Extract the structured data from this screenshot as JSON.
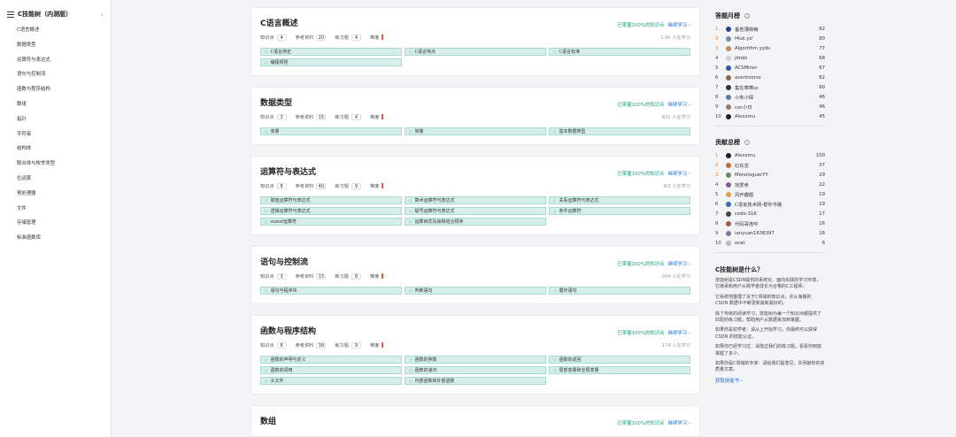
{
  "sidebar": {
    "title": "C技能树（内测版）",
    "items": [
      "C语言概述",
      "数据类型",
      "运算符与表达式",
      "语句与控制流",
      "函数与程序结构",
      "数组",
      "指针",
      "字符串",
      "结构体",
      "联合体与枚举类型",
      "位运算",
      "预处理器",
      "文件",
      "存储管理",
      "标准函数库"
    ]
  },
  "labels": {
    "knowledge": "知识点",
    "refs": "参考资料",
    "exercises": "练习题",
    "difficulty": "难度",
    "progress_link": "已掌握100%的知识点",
    "continue_link": "继续学习"
  },
  "cards": [
    {
      "title": "C语言概述",
      "k": "4",
      "r": "20",
      "e": "4",
      "learners": "1.9k 人在学习",
      "tags": [
        "C语言简史",
        "C语言特点",
        "C语言标准",
        "编程规则"
      ]
    },
    {
      "title": "数据类型",
      "k": "3",
      "r": "15",
      "e": "4",
      "learners": "821 人在学习",
      "tags": [
        "变量",
        "常量",
        "基本数据类型"
      ]
    },
    {
      "title": "运算符与表达式",
      "k": "8",
      "r": "40",
      "e": "9",
      "learners": "4/2 人在学习",
      "tags": [
        "赋值运算符与表达式",
        "算术运算符与表达式",
        "关系运算符与表达式",
        "逻辑运算符与表达式",
        "提号运算符与表达式",
        "条件运算符",
        "sizeof运算符",
        "运算目优先级和结合规序"
      ]
    },
    {
      "title": "语句与控制流",
      "k": "3",
      "r": "15",
      "e": "8",
      "learners": "204 人在学习",
      "tags": [
        "语句与程序块",
        "判断语句",
        "循环语句"
      ]
    },
    {
      "title": "函数与程序结构",
      "k": "8",
      "r": "38",
      "e": "9",
      "learners": "174 人在学习",
      "tags": [
        "函数的声明与定义",
        "函数的参数",
        "函数的返回",
        "函数的调用",
        "函数的递归",
        "局部变量和全局变量",
        "头文件",
        "内部函数和外部函数"
      ]
    },
    {
      "title": "数组",
      "k": "",
      "r": "",
      "e": "",
      "learners": "",
      "tags": []
    }
  ],
  "answer_board": {
    "title": "答题月榜",
    "rows": [
      {
        "rank": "1",
        "name": "垂若薄荷梅",
        "score": "82",
        "color": "#2b3f8f"
      },
      {
        "rank": "2",
        "name": "f4uk.yo'",
        "score": "80",
        "color": "#7a8aa0"
      },
      {
        "rank": "3",
        "name": "Algorithm yyds",
        "score": "77",
        "color": "#c48a5a"
      },
      {
        "rank": "4",
        "name": "jimds",
        "score": "68",
        "color": "#d0d0d0"
      },
      {
        "rank": "5",
        "name": "ACSMiner",
        "score": "67",
        "color": "#2f5d9a"
      },
      {
        "rank": "6",
        "name": "aventoorse",
        "score": "62",
        "color": "#8a6a4a"
      },
      {
        "rank": "7",
        "name": "集在寒寒sc",
        "score": "60",
        "color": "#333333"
      },
      {
        "rank": "8",
        "name": "小朱小琛",
        "score": "46",
        "color": "#5a7ab0"
      },
      {
        "rank": "9",
        "name": "coc小日",
        "score": "46",
        "color": "#9a7a6a"
      },
      {
        "rank": "10",
        "name": "Alexxmu",
        "score": "45",
        "color": "#222222"
      }
    ]
  },
  "contrib_board": {
    "title": "贡献总榜",
    "rows": [
      {
        "rank": "1",
        "name": "Alexxmu",
        "score": "100",
        "color": "#222222"
      },
      {
        "rank": "2",
        "name": "幻东龙",
        "score": "37",
        "color": "#c06a3a"
      },
      {
        "rank": "3",
        "name": "MonologuerYY",
        "score": "29",
        "color": "#6a8a6a"
      },
      {
        "rank": "4",
        "name": "找爱卖",
        "score": "22",
        "color": "#8a5a9a"
      },
      {
        "rank": "5",
        "name": "风开趣题",
        "score": "19",
        "color": "#e0a050"
      },
      {
        "rank": "6",
        "name": "C语言技术网-帮你今路",
        "score": "19",
        "color": "#3a6ab0"
      },
      {
        "rank": "7",
        "name": "code-316",
        "score": "17",
        "color": "#444444"
      },
      {
        "rank": "8",
        "name": "代码哥连呼",
        "score": "16",
        "color": "#a05a4a"
      },
      {
        "rank": "9",
        "name": "ianyuan1636397",
        "score": "16",
        "color": "#7a7a9a"
      },
      {
        "rank": "10",
        "name": "ocat",
        "score": "6",
        "color": "#bbbbbb"
      }
    ]
  },
  "about": {
    "title": "C技能树是什么？",
    "paragraphs": [
      "技能树是CSDN提供的系统化、面向实践的学习环境，它继承和用户从跨学者成长为合格的C工程师。",
      "它系统地整理了关于C领域的知识点，并从海量的 CSDN 数据中不断更新最新最好的。",
      "除了传统的阅读学习，技能树为每一个知识点都提供了匹配的练习题，帮助用户从数据来加到掌握。",
      "如果你是初学者：请从上开始学习，你最终可以获得 CSDN 的技能认证。",
      "如果你已经学习过：请借过我们的练习题，看看你到底掌握了多少。",
      "如果你是C领域的专家：请给我们提意见，并贡献你的高质量文章。"
    ],
    "more": "获取技能书"
  }
}
